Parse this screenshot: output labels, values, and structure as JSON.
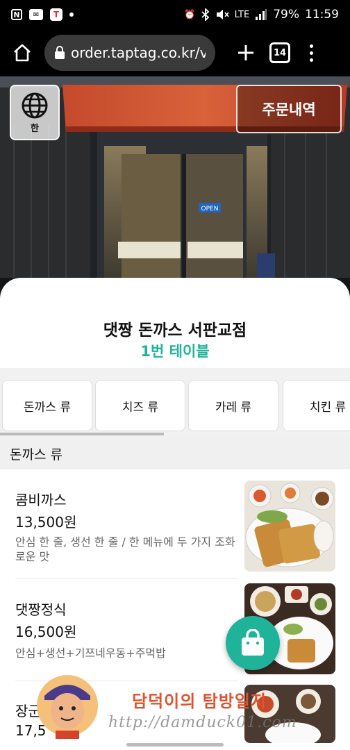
{
  "status_bar": {
    "left_icons": [
      "nfc-icon",
      "message-icon",
      "tmap-icon",
      "dot-icon"
    ],
    "n_glyph": "N",
    "t_glyph": "T",
    "lte_label": "LTE",
    "battery": "79%",
    "time": "11:59"
  },
  "browser": {
    "url": "order.taptag.co.kr/v",
    "tab_count": "14"
  },
  "hero": {
    "language_label": "한",
    "order_history_label": "주문내역",
    "open_sign": "OPEN"
  },
  "store": {
    "name": "댓짱 돈까스 서판교점",
    "table": "1번 테이블"
  },
  "categories": [
    "돈까스 류",
    "치즈 류",
    "카레 류",
    "치킨 류"
  ],
  "section_title": "돈까스 류",
  "menu": [
    {
      "name": "콤비까스",
      "price": "13,500원",
      "description": "안심 한 줄, 생선 한 줄 / 한 메뉴에 두 가지 조화로운 맛"
    },
    {
      "name": "댓짱정식",
      "price": "16,500원",
      "description": "안심+생선+기쯔네우동+주먹밥"
    },
    {
      "name": "장군",
      "price": "17,5"
    }
  ],
  "watermark": {
    "title": "담덕이의 탐방일지",
    "url": "http://damduck01.com"
  },
  "colors": {
    "accent": "#1fb39a",
    "status_bar": "#000000",
    "url_field": "#3a3a3a"
  }
}
